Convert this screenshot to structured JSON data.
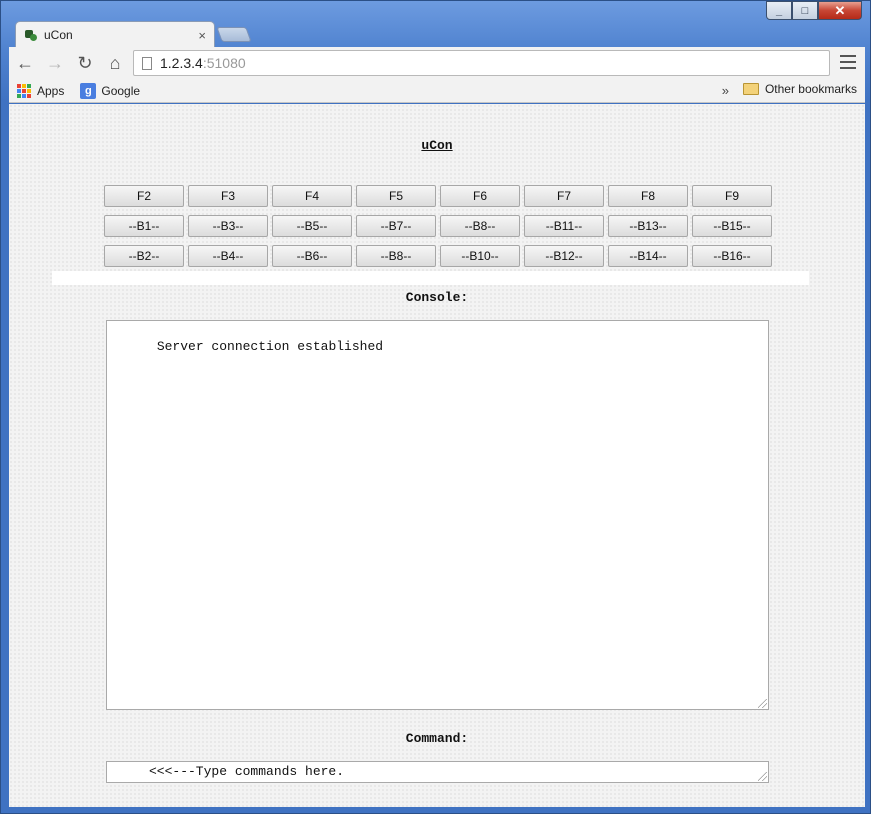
{
  "window": {
    "controls": [
      "minimize",
      "maximize",
      "close"
    ]
  },
  "tabs": [
    {
      "title": "uCon",
      "close": "×"
    }
  ],
  "toolbar": {
    "url_host": "1.2.3.4",
    "url_port": ":51080"
  },
  "bookmarks": {
    "apps": "Apps",
    "google": "Google",
    "google_icon": "g",
    "overflow": "»",
    "other": "Other bookmarks"
  },
  "page": {
    "title": "uCon",
    "function_keys": [
      "F2",
      "F3",
      "F4",
      "F5",
      "F6",
      "F7",
      "F8",
      "F9"
    ],
    "row2_buttons": [
      "--B1--",
      "--B3--",
      "--B5--",
      "--B7--",
      "--B8--",
      "--B11--",
      "--B13--",
      "--B15--"
    ],
    "row3_buttons": [
      "--B2--",
      "--B4--",
      "--B6--",
      "--B8--",
      "--B10--",
      "--B12--",
      "--B14--",
      "--B16--"
    ],
    "console_label": "Console:",
    "console_text": "Server connection established",
    "command_label": "Command:",
    "command_value": "<<<---Type commands here."
  },
  "colors": {
    "apps_grid": [
      "#e94235",
      "#fbbc05",
      "#34a853",
      "#4285f4",
      "#e94235",
      "#fbbc05",
      "#34a853",
      "#4285f4",
      "#e94235"
    ]
  }
}
